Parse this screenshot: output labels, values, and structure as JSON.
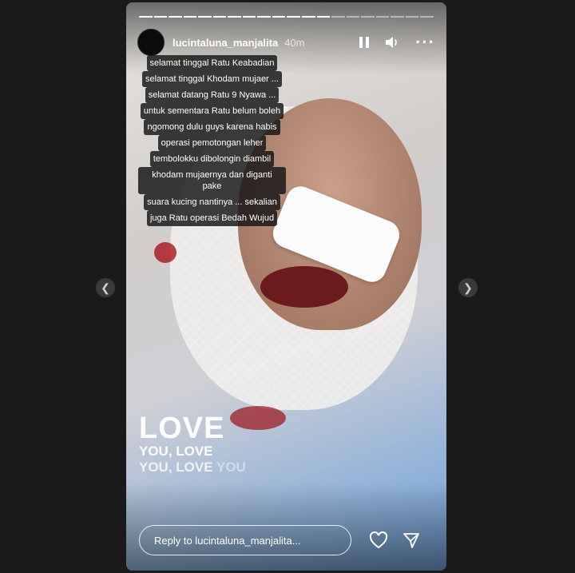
{
  "story": {
    "username": "lucintaluna_manjalita",
    "time": "40m",
    "progress_total": 20,
    "progress_done": 13
  },
  "caption": [
    "selamat tinggal Ratu Keabadian",
    "selamat tinggal Khodam mujaer ...",
    "selamat datang Ratu 9 Nyawa ...",
    "untuk sementara Ratu belum boleh",
    "ngomong dulu guys karena habis",
    "operasi pemotongan leher",
    "tembolokku dibolongin diambil",
    "khodam mujaernya dan diganti pake",
    "suara kucing nantinya ... sekalian",
    "juga Ratu operasi Bedah Wujud"
  ],
  "sticker": {
    "line1": "LOVE",
    "line2": "YOU, LOVE",
    "line3a": "YOU, LOVE ",
    "line3b": "YOU"
  },
  "footer": {
    "reply_placeholder": "Reply to lucintaluna_manjalita..."
  },
  "icons": {
    "pause": "pause-icon",
    "sound": "speaker-icon",
    "more": "more-icon",
    "like": "heart-icon",
    "send": "send-icon",
    "prev": "chevron-left-icon",
    "next": "chevron-right-icon"
  }
}
